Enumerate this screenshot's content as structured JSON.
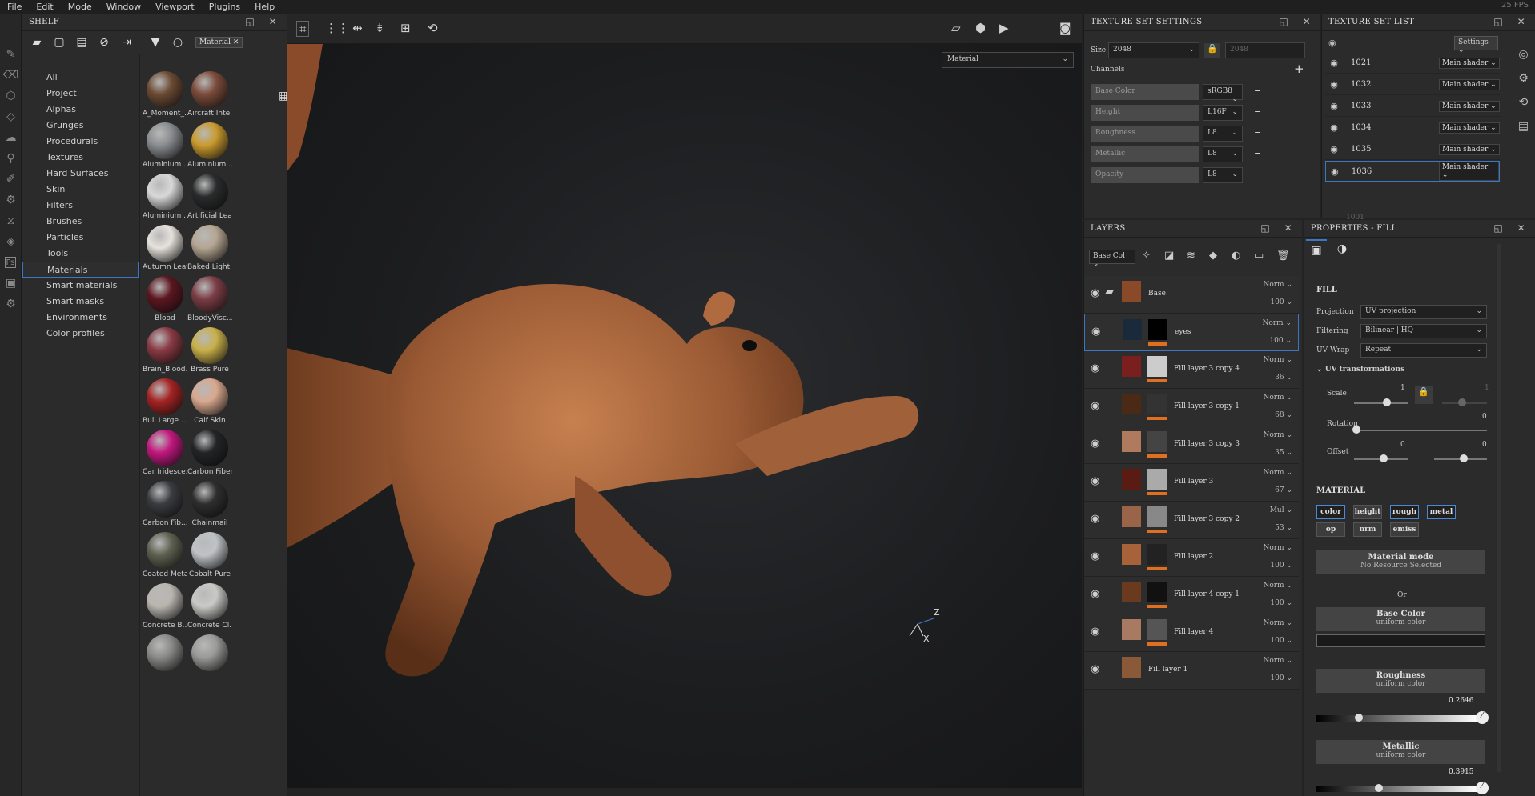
{
  "menu": [
    "File",
    "Edit",
    "Mode",
    "Window",
    "Viewport",
    "Plugins",
    "Help"
  ],
  "fps": "25 FPS",
  "shelf": {
    "title": "SHELF",
    "filter_tag": "Material",
    "categories": [
      "All",
      "Project",
      "Alphas",
      "Grunges",
      "Procedurals",
      "Textures",
      "Hard Surfaces",
      "Skin",
      "Filters",
      "Brushes",
      "Particles",
      "Tools",
      "Materials",
      "Smart materials",
      "Smart masks",
      "Environments",
      "Color profiles"
    ],
    "active_category": "Materials",
    "materials": [
      {
        "name": "A_Moment_...",
        "color": "#6b4a33"
      },
      {
        "name": "Aircraft Inte...",
        "color": "#7a4b3a"
      },
      {
        "name": "Aluminium ...",
        "color": "#8a8d90"
      },
      {
        "name": "Aluminium ...",
        "color": "#c99a2e"
      },
      {
        "name": "Aluminium ...",
        "color": "#d8d8d8"
      },
      {
        "name": "Artificial Lea...",
        "color": "#2a2b2c"
      },
      {
        "name": "Autumn Leaf",
        "color": "#e6e2dc"
      },
      {
        "name": "Baked Light...",
        "color": "#b5a692"
      },
      {
        "name": "Blood",
        "color": "#5c1620"
      },
      {
        "name": "BloodyVisc...",
        "color": "#7a3d45"
      },
      {
        "name": "Brain_Blood...",
        "color": "#8a3a44"
      },
      {
        "name": "Brass Pure",
        "color": "#c8b04a"
      },
      {
        "name": "Bull Large ...",
        "color": "#a52323"
      },
      {
        "name": "Calf Skin",
        "color": "#d9a88e"
      },
      {
        "name": "Car Iridesce...",
        "color": "#c2177e"
      },
      {
        "name": "Carbon Fiber",
        "color": "#222426"
      },
      {
        "name": "Carbon Fib...",
        "color": "#3a3c40"
      },
      {
        "name": "Chainmail",
        "color": "#2e2e2e"
      },
      {
        "name": "Coated Metal",
        "color": "#5e6150"
      },
      {
        "name": "Cobalt Pure",
        "color": "#bfc3c6"
      },
      {
        "name": "Concrete B...",
        "color": "#b9b6b0"
      },
      {
        "name": "Concrete Cl...",
        "color": "#c9c9c7"
      },
      {
        "name": "",
        "color": "#8a8a88"
      },
      {
        "name": "",
        "color": "#9a9a98"
      }
    ]
  },
  "viewport": {
    "material_select": "Material",
    "axis_z": "Z",
    "axis_x": "X"
  },
  "texture_set_settings": {
    "title": "TEXTURE SET SETTINGS",
    "size_label": "Size",
    "size_value": "2048",
    "size_placeholder": "2048",
    "channels_label": "Channels",
    "channels": [
      {
        "name": "Base Color",
        "format": "sRGB8"
      },
      {
        "name": "Height",
        "format": "L16F"
      },
      {
        "name": "Roughness",
        "format": "L8"
      },
      {
        "name": "Metallic",
        "format": "L8"
      },
      {
        "name": "Opacity",
        "format": "L8"
      }
    ]
  },
  "texture_set_list": {
    "title": "TEXTURE SET LIST",
    "settings_label": "Settings",
    "sets": [
      {
        "name": "1021",
        "shader": "Main shader"
      },
      {
        "name": "1032",
        "shader": "Main shader"
      },
      {
        "name": "1033",
        "shader": "Main shader"
      },
      {
        "name": "1034",
        "shader": "Main shader"
      },
      {
        "name": "1035",
        "shader": "Main shader"
      },
      {
        "name": "1036",
        "shader": "Main shader"
      }
    ],
    "disabled_set": "1001"
  },
  "layers": {
    "title": "LAYERS",
    "channel_select": "Base Col",
    "items": [
      {
        "name": "Base",
        "blend": "Norm",
        "opacity": "100",
        "thumb": "#8a4a2a",
        "mask": ""
      },
      {
        "name": "eyes",
        "blend": "Norm",
        "opacity": "100",
        "thumb": "#1a2a3a",
        "mask": "#000000"
      },
      {
        "name": "Fill layer 3 copy 4",
        "blend": "Norm",
        "opacity": "36",
        "thumb": "#7a1e1e",
        "mask": "#cccccc"
      },
      {
        "name": "Fill layer 3 copy 1",
        "blend": "Norm",
        "opacity": "68",
        "thumb": "#4a2a14",
        "mask": "#333333"
      },
      {
        "name": "Fill layer 3 copy 3",
        "blend": "Norm",
        "opacity": "35",
        "thumb": "#b07a5e",
        "mask": "#444444"
      },
      {
        "name": "Fill layer 3",
        "blend": "Norm",
        "opacity": "67",
        "thumb": "#5a1c12",
        "mask": "#aaaaaa"
      },
      {
        "name": "Fill layer 3 copy 2",
        "blend": "Mul",
        "opacity": "53",
        "thumb": "#9a6448",
        "mask": "#888888"
      },
      {
        "name": "Fill layer 2",
        "blend": "Norm",
        "opacity": "100",
        "thumb": "#a8623a",
        "mask": "#222222"
      },
      {
        "name": "Fill layer 4 copy 1",
        "blend": "Norm",
        "opacity": "100",
        "thumb": "#6a3a1e",
        "mask": "#111111"
      },
      {
        "name": "Fill layer 4",
        "blend": "Norm",
        "opacity": "100",
        "thumb": "#a87a62",
        "mask": "#555555"
      },
      {
        "name": "Fill layer 1",
        "blend": "Norm",
        "opacity": "100",
        "thumb": "#8a5a38",
        "mask": ""
      }
    ]
  },
  "properties": {
    "title": "PROPERTIES - FILL",
    "fill_label": "FILL",
    "projection_label": "Projection",
    "projection": "UV projection",
    "filtering_label": "Filtering",
    "filtering": "Bilinear | HQ",
    "uvwrap_label": "UV Wrap",
    "uvwrap": "Repeat",
    "uvtrans_label": "UV transformations",
    "scale_label": "Scale",
    "scale_value": "1",
    "scale_value2": "1",
    "rotation_label": "Rotation",
    "rotation_value": "0",
    "offset_label": "Offset",
    "offset_value1": "0",
    "offset_value2": "0",
    "material_label": "MATERIAL",
    "channel_buttons": [
      {
        "label": "color",
        "on": true
      },
      {
        "label": "height",
        "on": false
      },
      {
        "label": "rough",
        "on": true
      },
      {
        "label": "metal",
        "on": true
      },
      {
        "label": "op",
        "on": false
      },
      {
        "label": "nrm",
        "on": false
      },
      {
        "label": "emiss",
        "on": false
      }
    ],
    "material_mode": "Material mode",
    "no_resource": "No Resource Selected",
    "or_label": "Or",
    "base_color": "Base Color",
    "base_color_sub": "uniform color",
    "base_color_swatch": "#1a1a1a",
    "roughness": "Roughness",
    "roughness_sub": "uniform color",
    "roughness_value": "0.2646",
    "metallic": "Metallic",
    "metallic_sub": "uniform color",
    "metallic_value": "0.3915"
  }
}
